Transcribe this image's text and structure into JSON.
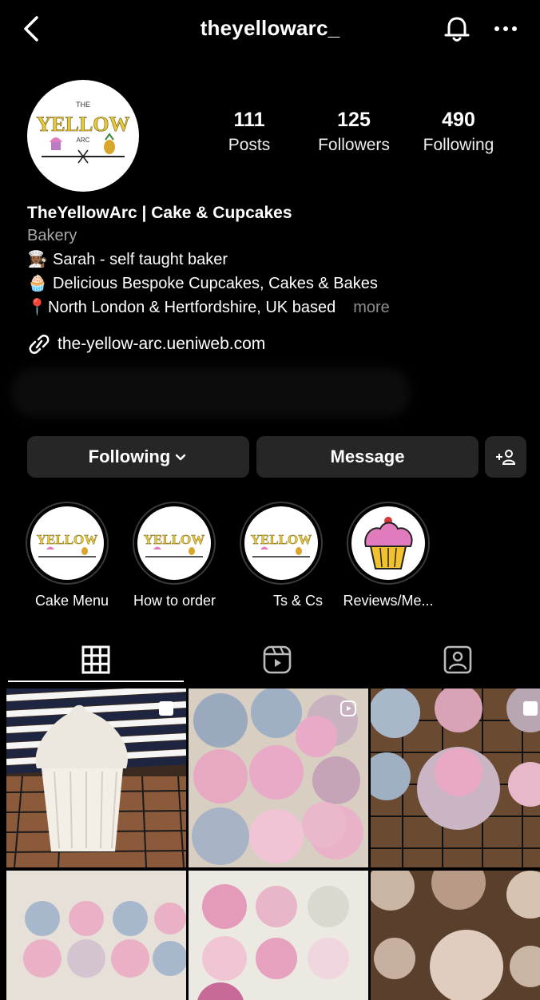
{
  "header": {
    "handle": "theyellowarc_"
  },
  "profile": {
    "logo": {
      "top": "THE",
      "main": "YELLOW",
      "sub": "ARC"
    },
    "stats": [
      {
        "value": "111",
        "label": "Posts"
      },
      {
        "value": "125",
        "label": "Followers"
      },
      {
        "value": "490",
        "label": "Following"
      }
    ],
    "name": "TheYellowArc | Cake & Cupcakes",
    "category": "Bakery",
    "bio_lines": [
      {
        "emoji": "👩🏾‍🍳",
        "text": "Sarah - self taught baker"
      },
      {
        "emoji": "🧁",
        "text": "Delicious Bespoke Cupcakes, Cakes & Bakes"
      },
      {
        "emoji": "📍",
        "text": "North London & Hertfordshire, UK based"
      }
    ],
    "more_label": "more",
    "link": "the-yellow-arc.ueniweb.com"
  },
  "actions": {
    "following_label": "Following",
    "message_label": "Message"
  },
  "highlights": [
    {
      "label": "Cake Menu"
    },
    {
      "label": "How to order"
    },
    {
      "label": "Ts & Cs"
    },
    {
      "label": "Reviews/Me..."
    }
  ],
  "tabs": [
    "grid-tab",
    "reels-tab",
    "tagged-tab"
  ],
  "colors": {
    "background": "#000000",
    "button": "#262626",
    "logo_yellow": "#e8c93a",
    "cupcake_pink": "#e27bbd"
  }
}
